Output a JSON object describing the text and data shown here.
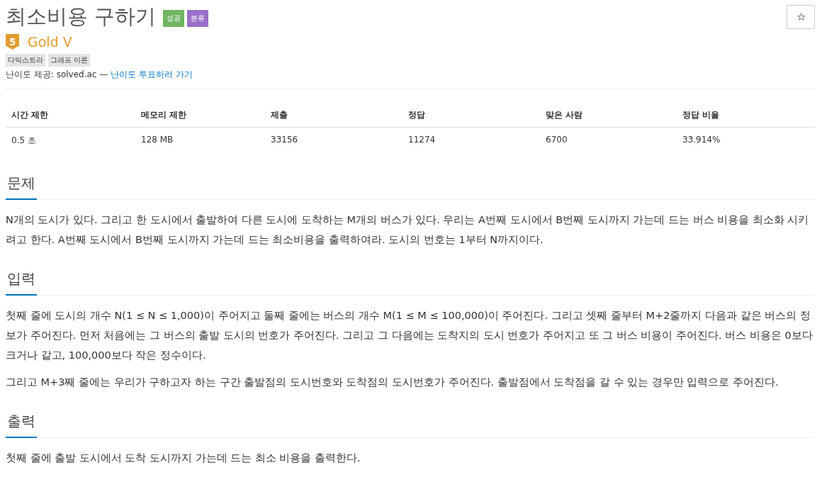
{
  "title": "최소비용 구하기",
  "badges": [
    {
      "label": "성공",
      "color": "#6fb562"
    },
    {
      "label": "분류",
      "color": "#9a6fc9"
    }
  ],
  "star_button": "☆",
  "tier": {
    "number": "5",
    "name": "Gold V"
  },
  "tags": [
    "다익스트라",
    "그래프 이론"
  ],
  "difficulty_credit": {
    "text": "난이도 제공: solved.ac —",
    "link": "난이도 투표하러 가기"
  },
  "stats_table": {
    "columns": [
      "시간 제한",
      "메모리 제한",
      "제출",
      "정답",
      "맞은 사람",
      "정답 비율"
    ],
    "rows": [
      [
        "0.5 초",
        "128 MB",
        "33156",
        "11274",
        "6700",
        "33.914%"
      ]
    ]
  },
  "sections": [
    {
      "heading": "문제",
      "paragraphs": [
        "N개의 도시가 있다. 그리고 한 도시에서 출발하여 다른 도시에 도착하는 M개의 버스가 있다. 우리는 A번째 도시에서 B번째 도시까지 가는데 드는 버스 비용을 최소화 시키려고 한다. A번째 도시에서 B번째 도시까지 가는데 드는 최소비용을 출력하여라. 도시의 번호는 1부터 N까지이다."
      ]
    },
    {
      "heading": "입력",
      "paragraphs": [
        "첫째 줄에 도시의 개수 N(1 ≤ N ≤ 1,000)이 주어지고 둘째 줄에는 버스의 개수 M(1 ≤ M ≤ 100,000)이 주어진다. 그리고 셋째 줄부터 M+2줄까지 다음과 같은 버스의 정보가 주어진다. 먼저 처음에는 그 버스의 출발 도시의 번호가 주어진다. 그리고 그 다음에는 도착지의 도시 번호가 주어지고 또 그 버스 비용이 주어진다. 버스 비용은 0보다 크거나 같고, 100,000보다 작은 정수이다.",
        "그리고 M+3째 줄에는 우리가 구하고자 하는 구간 출발점의 도시번호와 도착점의 도시번호가 주어진다. 출발점에서 도착점을 갈 수 있는 경우만 입력으로 주어진다."
      ]
    },
    {
      "heading": "출력",
      "paragraphs": [
        "첫째 줄에 출발 도시에서 도착 도시까지 가는데 드는 최소 비용을 출력한다."
      ]
    }
  ]
}
